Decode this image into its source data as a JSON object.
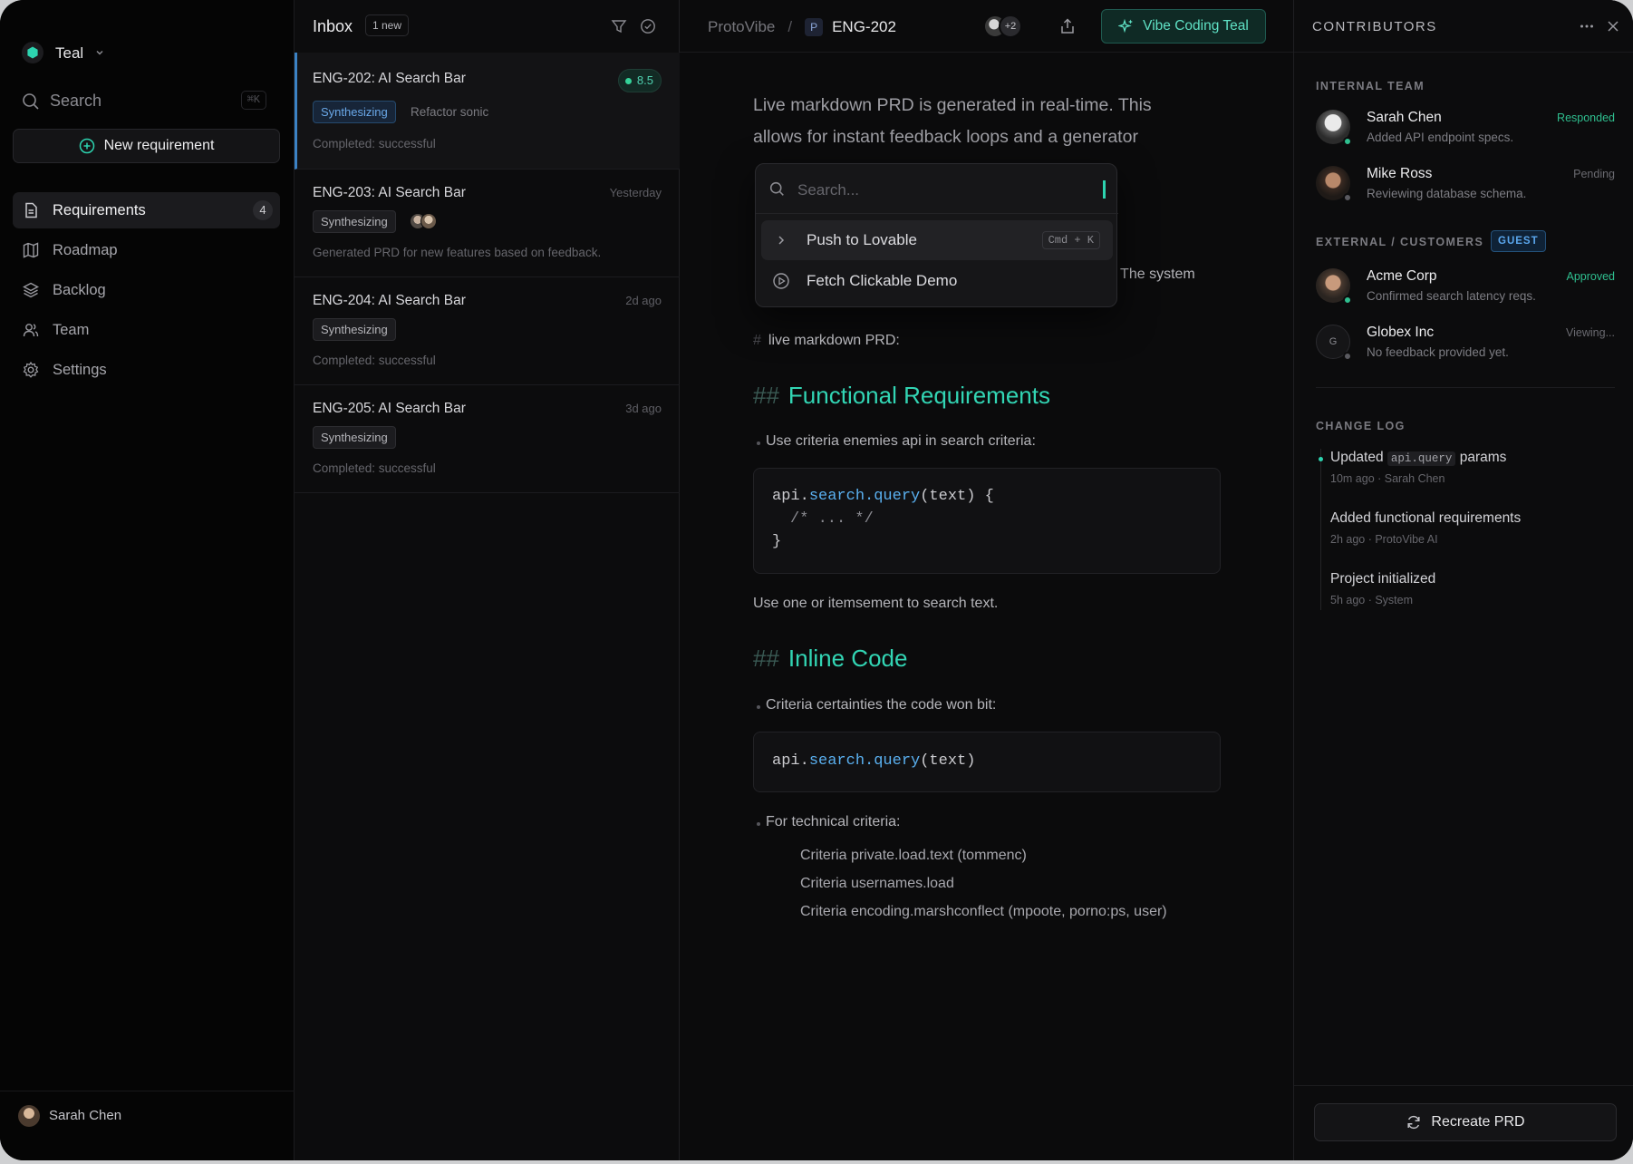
{
  "workspace": {
    "name": "Teal",
    "search_label": "Search",
    "search_shortcut": "⌘K",
    "new_requirement": "New requirement"
  },
  "nav": [
    {
      "label": "Requirements",
      "count": "4",
      "icon": "document-icon"
    },
    {
      "label": "Roadmap",
      "icon": "map-icon"
    },
    {
      "label": "Backlog",
      "icon": "layers-icon"
    },
    {
      "label": "Team",
      "icon": "users-icon"
    },
    {
      "label": "Settings",
      "icon": "gear-icon"
    }
  ],
  "current_user": {
    "name": "Sarah Chen"
  },
  "inbox": {
    "title": "Inbox",
    "new_badge": "1 new",
    "items": [
      {
        "title": "ENG-202: AI Search Bar",
        "score": "8.5",
        "tag": "Synthesizing",
        "extra": "Refactor sonic",
        "subtitle": "Completed: successful"
      },
      {
        "title": "ENG-203: AI Search Bar",
        "time": "Yesterday",
        "tag": "Synthesizing",
        "subtitle": "Generated PRD for new features based on feedback."
      },
      {
        "title": "ENG-204: AI Search Bar",
        "time": "2d ago",
        "tag": "Synthesizing",
        "subtitle": "Completed: successful"
      },
      {
        "title": "ENG-205: AI Search Bar",
        "time": "3d ago",
        "tag": "Synthesizing",
        "subtitle": "Completed: successful"
      }
    ]
  },
  "header": {
    "project": "ProtoVibe",
    "separator": "/",
    "project_badge": "P",
    "ticket": "ENG-202",
    "avatars_more": "+2",
    "vibe_button": "Vibe Coding Teal"
  },
  "doc": {
    "intro_1": "Live markdown PRD is generated in real-time. This",
    "intro_2": "allows for instant feedback loops and a generator",
    "partial_line": "ts. The system",
    "hash_line_mark": "#",
    "hash_line": "live markdown PRD:",
    "h2_mark": "##",
    "section1": "Functional Requirements",
    "bullet1": "Use criteria enemies api in search criteria:",
    "code1": {
      "line1_a": "api.",
      "line1_b": "search.query",
      "line1_c": "(text) {",
      "line2": "/* ... */",
      "line3": "}"
    },
    "para": "Use one or itemsement to search text.",
    "section2": "Inline Code",
    "bullet2": "Criteria certainties the code won bit:",
    "code2": {
      "a": "api.",
      "b": "search.query",
      "c": "(text)"
    },
    "bullet3": "For technical criteria:",
    "sub1": "Criteria private.load.text (tommenc)",
    "sub2": "Criteria usernames.load",
    "sub3": "Criteria encoding.marshconflect (mpoote, porno:ps, user)"
  },
  "palette": {
    "placeholder": "Search...",
    "item1": "Push to Lovable",
    "item1_shortcut": "Cmd + K",
    "item2": "Fetch Clickable Demo"
  },
  "contributors": {
    "title": "CONTRIBUTORS",
    "internal_label": "INTERNAL TEAM",
    "external_label": "EXTERNAL / CUSTOMERS",
    "guest_badge": "GUEST",
    "people": [
      {
        "name": "Sarah Chen",
        "desc": "Added API endpoint specs.",
        "status": "Responded",
        "status_color": "#2fbf8f"
      },
      {
        "name": "Mike Ross",
        "desc": "Reviewing database schema.",
        "status": "Pending",
        "status_color": "#6a6a70"
      },
      {
        "name": "Acme Corp",
        "desc": "Confirmed search latency reqs.",
        "status": "Approved",
        "status_color": "#2fbf8f"
      },
      {
        "name": "Globex Inc",
        "initial": "G",
        "desc": "No feedback provided yet.",
        "status": "Viewing...",
        "status_color": "#6a6a70"
      }
    ],
    "changelog_label": "CHANGE LOG",
    "log": [
      {
        "pre": "Updated",
        "code": "api.query",
        "post": "params",
        "meta": "10m ago · Sarah Chen"
      },
      {
        "text": "Added functional requirements",
        "meta": "2h ago · ProtoVibe AI"
      },
      {
        "text": "Project initialized",
        "meta": "5h ago · System"
      }
    ],
    "recreate_button": "Recreate PRD"
  },
  "colors": {
    "accent": "#2dd4b0",
    "selected_border": "#3b82c4"
  }
}
